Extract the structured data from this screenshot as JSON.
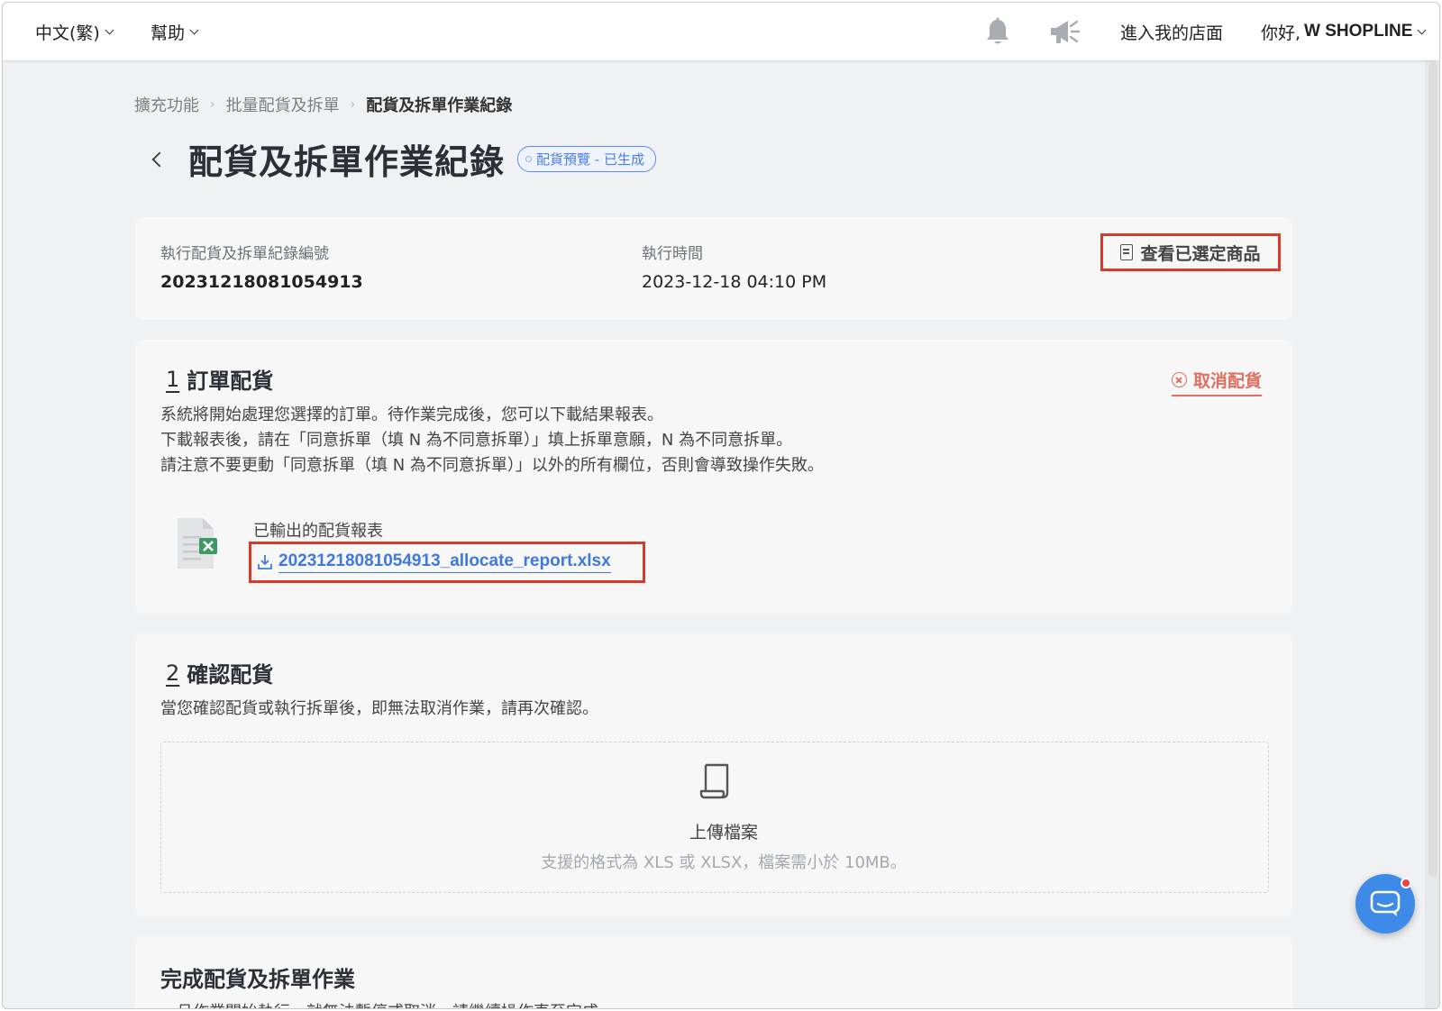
{
  "topbar": {
    "language": "中文(繁)",
    "help": "幫助",
    "enter_store": "進入我的店面",
    "greeting_prefix": "你好,",
    "user_name": "W SHOPLINE"
  },
  "breadcrumb": {
    "items": [
      "擴充功能",
      "批量配貨及拆單",
      "配貨及拆單作業紀錄"
    ]
  },
  "page": {
    "title": "配貨及拆單作業紀錄",
    "status_badge": "配貨預覽 - 已生成"
  },
  "info": {
    "record_id_label": "執行配貨及拆單紀錄編號",
    "record_id": "20231218081054913",
    "exec_time_label": "執行時間",
    "exec_time": "2023-12-18 04:10 PM",
    "view_selected_button": "查看已選定商品"
  },
  "step1": {
    "number": "1",
    "title": "訂單配貨",
    "cancel_link": "取消配貨",
    "lines": [
      "系統將開始處理您選擇的訂單。待作業完成後，您可以下載結果報表。",
      "下載報表後，請在「同意拆單（填 N 為不同意拆單）」填上拆單意願，N 為不同意拆單。",
      "請注意不要更動「同意拆單（填 N 為不同意拆單）」以外的所有欄位，否則會導致操作失敗。"
    ],
    "report_label": "已輸出的配貨報表",
    "report_file": "20231218081054913_allocate_report.xlsx"
  },
  "step2": {
    "number": "2",
    "title": "確認配貨",
    "description": "當您確認配貨或執行拆單後，即無法取消作業，請再次確認。",
    "upload_title": "上傳檔案",
    "upload_hint": "支援的格式為 XLS 或 XLSX，檔案需小於 10MB。"
  },
  "step3": {
    "title": "完成配貨及拆單作業",
    "description": "一旦作業開始執行，就無法暫停或取消，請繼續操作直至完成。"
  },
  "colors": {
    "accent_blue": "#3e78e0",
    "highlight_red": "#d93a2b",
    "cancel_red": "#e06f5f",
    "chat_blue": "#3d8ae8"
  },
  "icons": [
    "chevron-down-icon",
    "bell-icon",
    "megaphone-icon",
    "back-chevron-icon",
    "document-icon",
    "x-circle-icon",
    "excel-file-icon",
    "download-icon",
    "upload-file-icon",
    "chat-icon"
  ]
}
